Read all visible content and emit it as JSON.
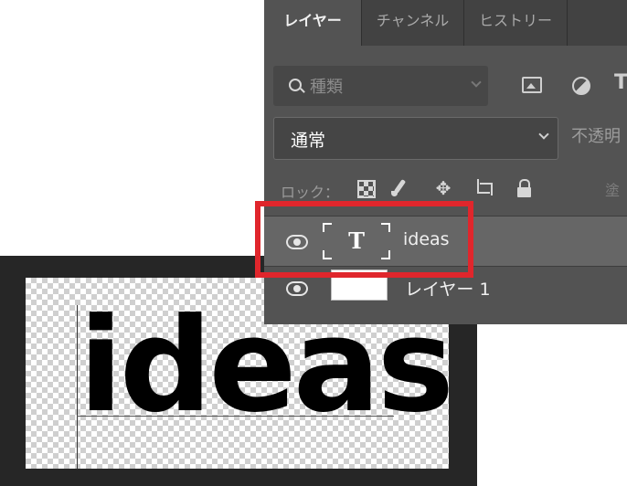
{
  "tabs": [
    "レイヤー",
    "チャンネル",
    "ヒストリー"
  ],
  "filter": {
    "label": "種類"
  },
  "filter_icons": [
    "image-filter-icon",
    "adjustment-filter-icon",
    "type-filter-icon"
  ],
  "blend_mode": {
    "value": "通常"
  },
  "opacity_label": "不透明",
  "lock_label": "ロック：",
  "lock_icons": [
    "lock-transparent-pixels-icon",
    "lock-image-pixels-icon",
    "lock-position-icon",
    "artboard-lock-icon",
    "lock-all-icon"
  ],
  "fill_hint": "塗",
  "layers": [
    {
      "name": "ideas",
      "thumb": "T",
      "selected": true
    },
    {
      "name": "レイヤー 1",
      "selected": false
    }
  ],
  "canvas": {
    "text": "ideas"
  },
  "colors": {
    "highlight": "#e0262c",
    "panel_bg": "#535353",
    "selected_row": "#666666"
  }
}
